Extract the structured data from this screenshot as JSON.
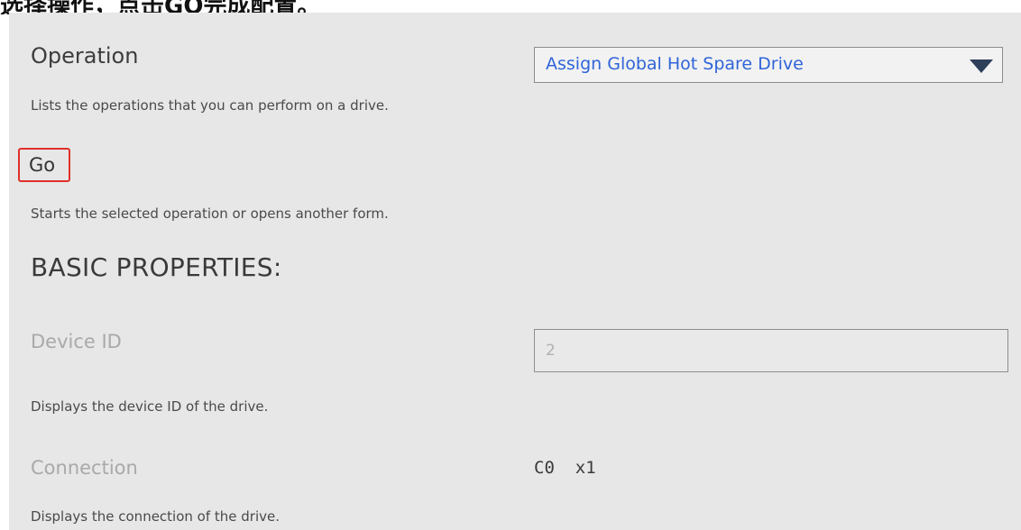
{
  "caption": "选择操作，点击GO完成配置。",
  "operation": {
    "label": "Operation",
    "help": "Lists the operations that you can perform on a drive.",
    "selected": "Assign Global Hot Spare Drive"
  },
  "go": {
    "label": "Go",
    "help": "Starts the selected operation or opens another form."
  },
  "basic": {
    "heading": "BASIC PROPERTIES:",
    "device_id": {
      "label": "Device ID",
      "value": "2",
      "help": "Displays the device ID of the drive."
    },
    "connection": {
      "label": "Connection",
      "value": "C0  x1",
      "help": "Displays the connection of the drive."
    }
  },
  "colors": {
    "highlight": "#e0302a",
    "selected_text": "#2f64d8",
    "panel": "#e7e7e7"
  }
}
